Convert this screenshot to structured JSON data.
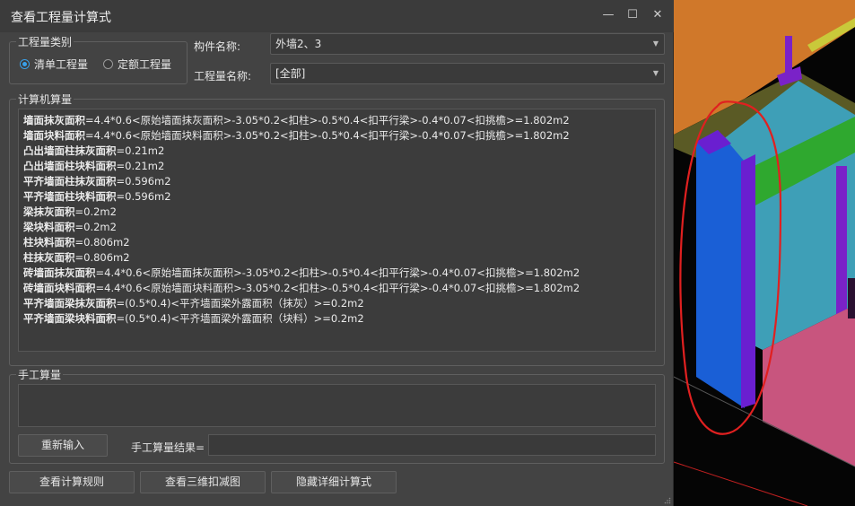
{
  "window": {
    "title": "查看工程量计算式",
    "minimize_glyph": "—",
    "maximize_glyph": "☐",
    "close_glyph": "✕"
  },
  "quantity_type": {
    "group_label": "工程量类别",
    "options": [
      {
        "label": "清单工程量",
        "selected": true
      },
      {
        "label": "定额工程量",
        "selected": false
      }
    ]
  },
  "component": {
    "label": "构件名称:",
    "value": "外墙2、3"
  },
  "quantity_name": {
    "label": "工程量名称:",
    "value": "[全部]"
  },
  "computed": {
    "group_label": "计算机算量",
    "lines": [
      {
        "name": "墙面抹灰面积",
        "expr": "=4.4*0.6<原始墙面抹灰面积>-3.05*0.2<扣柱>-0.5*0.4<扣平行梁>-0.4*0.07<扣挑檐>=1.802m2"
      },
      {
        "name": "墙面块料面积",
        "expr": "=4.4*0.6<原始墙面块料面积>-3.05*0.2<扣柱>-0.5*0.4<扣平行梁>-0.4*0.07<扣挑檐>=1.802m2"
      },
      {
        "name": "凸出墙面柱抹灰面积",
        "expr": "=0.21m2"
      },
      {
        "name": "凸出墙面柱块料面积",
        "expr": "=0.21m2"
      },
      {
        "name": "平齐墙面柱抹灰面积",
        "expr": "=0.596m2"
      },
      {
        "name": "平齐墙面柱块料面积",
        "expr": "=0.596m2"
      },
      {
        "name": "梁抹灰面积",
        "expr": "=0.2m2"
      },
      {
        "name": "梁块料面积",
        "expr": "=0.2m2"
      },
      {
        "name": "柱块料面积",
        "expr": "=0.806m2"
      },
      {
        "name": "柱抹灰面积",
        "expr": "=0.806m2"
      },
      {
        "name": "砖墙面抹灰面积",
        "expr": "=4.4*0.6<原始墙面抹灰面积>-3.05*0.2<扣柱>-0.5*0.4<扣平行梁>-0.4*0.07<扣挑檐>=1.802m2"
      },
      {
        "name": "砖墙面块料面积",
        "expr": "=4.4*0.6<原始墙面块料面积>-3.05*0.2<扣柱>-0.5*0.4<扣平行梁>-0.4*0.07<扣挑檐>=1.802m2"
      },
      {
        "name": "平齐墙面梁抹灰面积",
        "expr": "=(0.5*0.4)<平齐墙面梁外露面积（抹灰）>=0.2m2"
      },
      {
        "name": "平齐墙面梁块料面积",
        "expr": "=(0.5*0.4)<平齐墙面梁外露面积（块料）>=0.2m2"
      }
    ]
  },
  "manual": {
    "group_label": "手工算量",
    "reenter_button": "重新输入",
    "result_label": "手工算量结果=",
    "result_value": ""
  },
  "footer": {
    "view_rules": "查看计算规则",
    "view_3d": "查看三维扣减图",
    "hide_detail": "隐藏详细计算式"
  },
  "colors": {
    "accent": "#3aa0e8",
    "dialog_bg": "#434343",
    "annotation": "#e02020"
  },
  "icons": {
    "combo_arrow": "chevron-down-icon",
    "resize": "resize-grip-icon"
  }
}
